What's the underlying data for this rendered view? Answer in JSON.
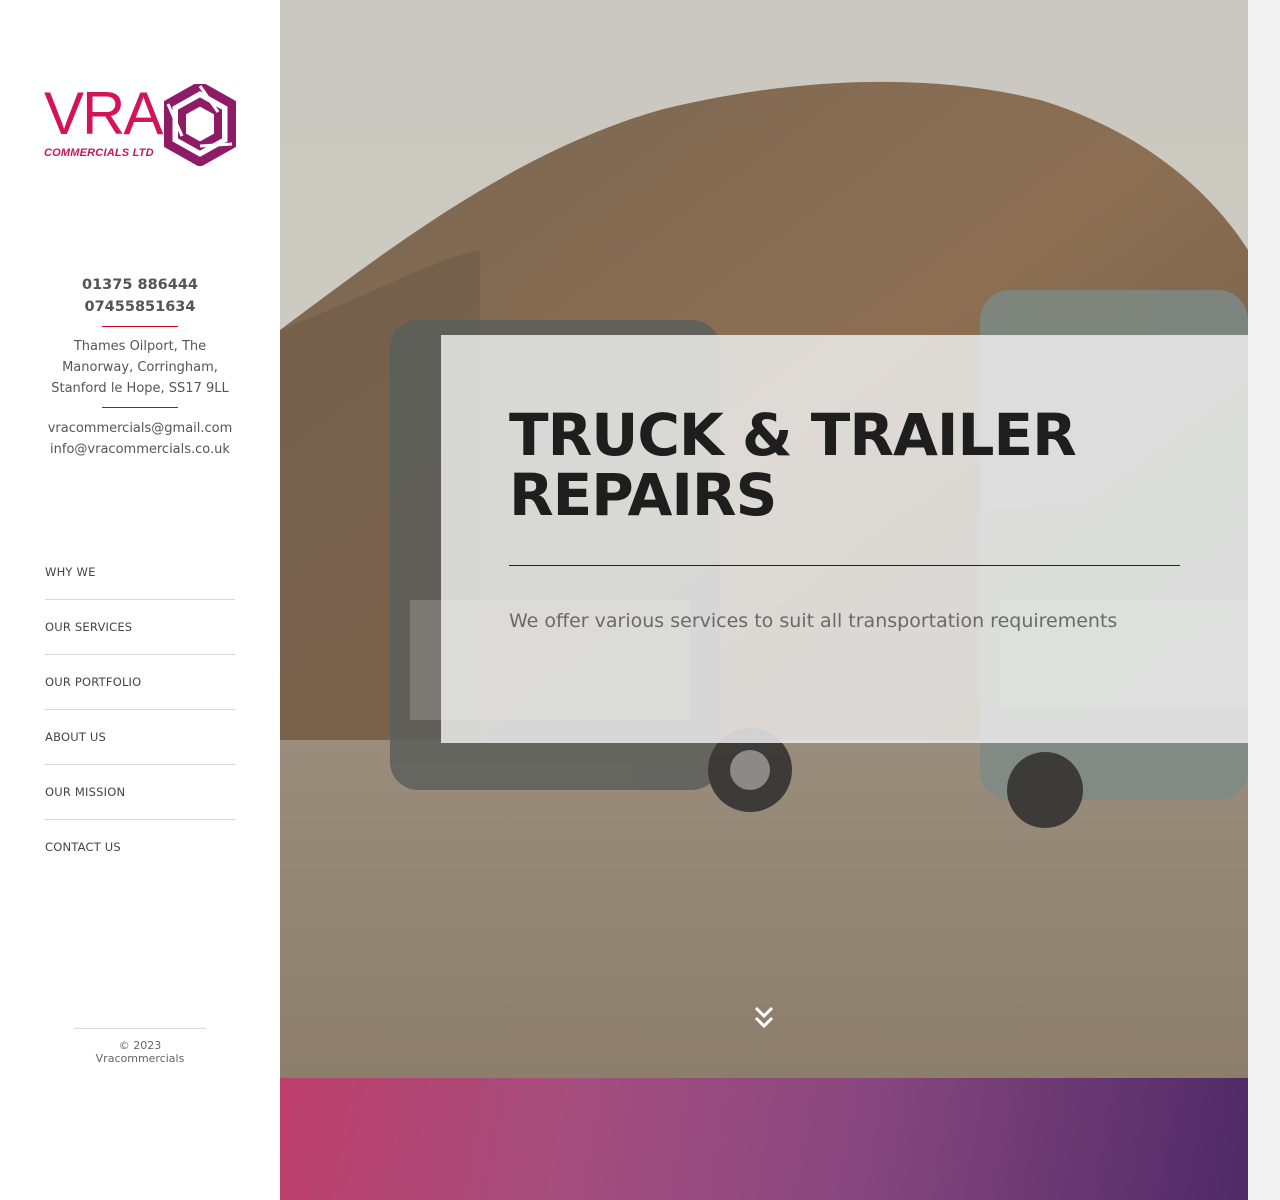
{
  "brand": {
    "name": "VRA",
    "subtitle": "COMMERCIALS LTD",
    "colors": {
      "primary": "#d4145a",
      "mark": "#8e1b66"
    }
  },
  "contact": {
    "phones": [
      "01375 886444",
      "07455851634"
    ],
    "address": "Thames Oilport, The Manorway, Corringham, Stanford le Hope, SS17 9LL",
    "emails": [
      "vracommercials@gmail.com",
      "info@vracommercials.co.uk"
    ]
  },
  "nav": {
    "items": [
      {
        "label": "WHY WE"
      },
      {
        "label": "OUR SERVICES"
      },
      {
        "label": "OUR PORTFOLIO"
      },
      {
        "label": "ABOUT US"
      },
      {
        "label": "OUR MISSION"
      },
      {
        "label": "CONTACT US"
      }
    ]
  },
  "footer": {
    "copyright": "© 2023 Vracommercials"
  },
  "hero": {
    "title": "TRUCK & TRAILER REPAIRS",
    "subtitle": "We offer various services to suit all transportation requirements",
    "scroll_icon": "double-chevron-down-icon"
  },
  "colors": {
    "accent_rule": "#d0021b",
    "band_gradient": [
      "#bd3f6a",
      "#4e2a66"
    ]
  }
}
